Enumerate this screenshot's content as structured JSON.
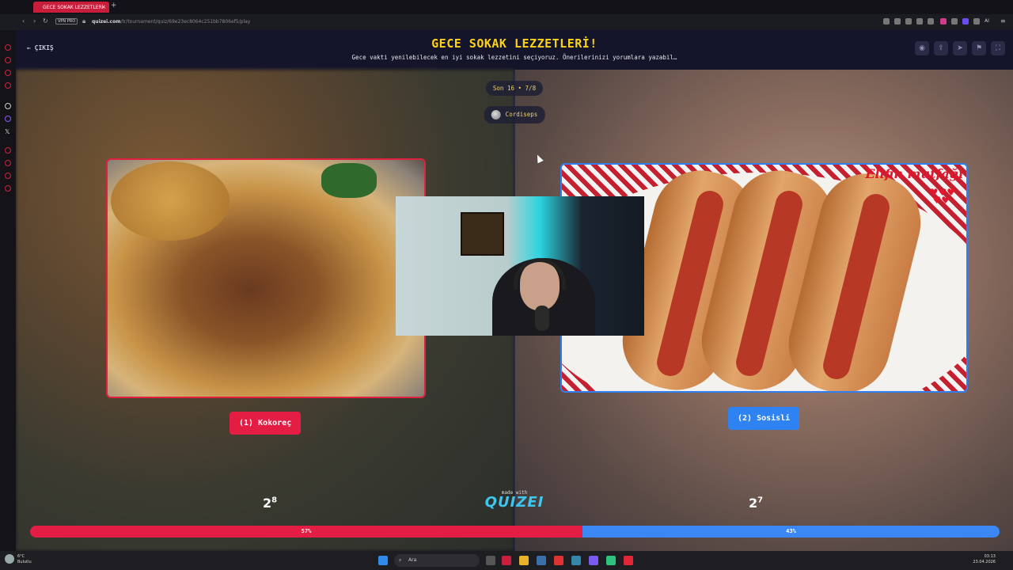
{
  "browser": {
    "tab_title": "GECE SOKAK LEZZETLERİ",
    "tab_close": "×",
    "new_tab": "+",
    "vpn_label": "VPN PRO",
    "url_host": "quizei.com",
    "url_path": "/tr/tournament/quiz/69e23ec8064c251bb7806ef5/play",
    "ai_label": "AI"
  },
  "header": {
    "back_label": "ÇIKIŞ",
    "title": "GECE SOKAK LEZZETLERİ!",
    "subtitle": "Gece vakti yenilebilecek en iyi sokak lezzetini seçiyoruz. Önerilerinizi yorumlara yazabil…",
    "actions": [
      "eye-icon",
      "share-icon",
      "send-icon",
      "flag-icon",
      "fullscreen-icon"
    ]
  },
  "match": {
    "round_label": "Son 16 • 7/8",
    "creator": "Cordiseps"
  },
  "left": {
    "label": "(1) Kokoreç",
    "count_base": "2",
    "count_sup": "8",
    "percent": "57%",
    "color": "#e31d43"
  },
  "right": {
    "label": "(2) Sosisli",
    "count_base": "2",
    "count_sup": "7",
    "percent": "43%",
    "color": "#2f82f2",
    "watermark": "Elifin mutfağı"
  },
  "vote_share": {
    "left": 0.57,
    "right": 0.43
  },
  "footer": {
    "made_with": "made with",
    "brand": "QUIZEI"
  },
  "taskbar": {
    "temp": "6°C",
    "weather": "Bulutlu",
    "search_placeholder": "Ara",
    "time": "03:13",
    "date": "23.04.2026"
  }
}
